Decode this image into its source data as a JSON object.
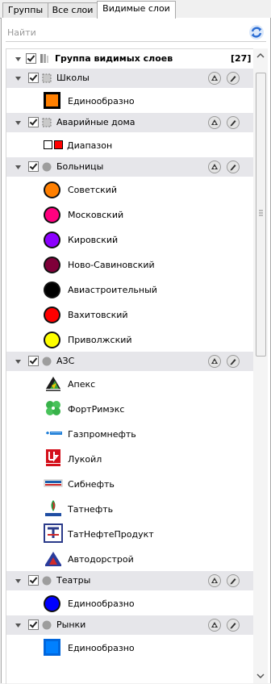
{
  "tabs": [
    {
      "label": "Группы"
    },
    {
      "label": "Все слои"
    },
    {
      "label": "Видимые слои",
      "active": true
    }
  ],
  "search": {
    "placeholder": "Найти"
  },
  "root": {
    "label": "Группа видимых слоев",
    "count": "[27]"
  },
  "layers": [
    {
      "name": "Школы",
      "symbol": "square-dashed",
      "items": [
        {
          "label": "Единообразно",
          "symbol": "square",
          "color": "#ff7f00",
          "border": "#000000"
        }
      ]
    },
    {
      "name": "Аварийные дома",
      "symbol": "square-dashed",
      "items": [
        {
          "label": "Диапазон",
          "symbol": "range",
          "colors": [
            "#ffffff",
            "#ff0000"
          ]
        }
      ]
    },
    {
      "name": "Больницы",
      "symbol": "circle-gray",
      "items": [
        {
          "label": "Советский",
          "symbol": "circle",
          "color": "#ff7f00"
        },
        {
          "label": "Московский",
          "symbol": "circle",
          "color": "#ff007f"
        },
        {
          "label": "Кировский",
          "symbol": "circle",
          "color": "#8c00ff"
        },
        {
          "label": "Ново-Савиновский",
          "symbol": "circle",
          "color": "#7f0039"
        },
        {
          "label": "Авиастроительный",
          "symbol": "circle",
          "color": "#000000"
        },
        {
          "label": "Вахитовский",
          "symbol": "circle",
          "color": "#ff0000"
        },
        {
          "label": "Приволжский",
          "symbol": "circle",
          "color": "#ffff00"
        }
      ]
    },
    {
      "name": "АЗС",
      "symbol": "circle-gray",
      "items": [
        {
          "label": "Апекс",
          "symbol": "logo-apex"
        },
        {
          "label": "ФортРимэкс",
          "symbol": "logo-clover"
        },
        {
          "label": "Газпромнефть",
          "symbol": "logo-gazprom"
        },
        {
          "label": "Лукойл",
          "symbol": "logo-lukoil"
        },
        {
          "label": "Сибнефть",
          "symbol": "logo-sibneft"
        },
        {
          "label": "Татнефть",
          "symbol": "logo-tatneft"
        },
        {
          "label": "ТатНефтеПродукт",
          "symbol": "logo-tnp"
        },
        {
          "label": "Автодорстрой",
          "symbol": "logo-avtodor"
        }
      ]
    },
    {
      "name": "Театры",
      "symbol": "circle-gray",
      "items": [
        {
          "label": "Единообразно",
          "symbol": "circle",
          "color": "#0000ff"
        }
      ]
    },
    {
      "name": "Рынки",
      "symbol": "circle-gray",
      "items": [
        {
          "label": "Единообразно",
          "symbol": "square",
          "color": "#0080ff",
          "border": "#0066dd"
        }
      ]
    }
  ]
}
